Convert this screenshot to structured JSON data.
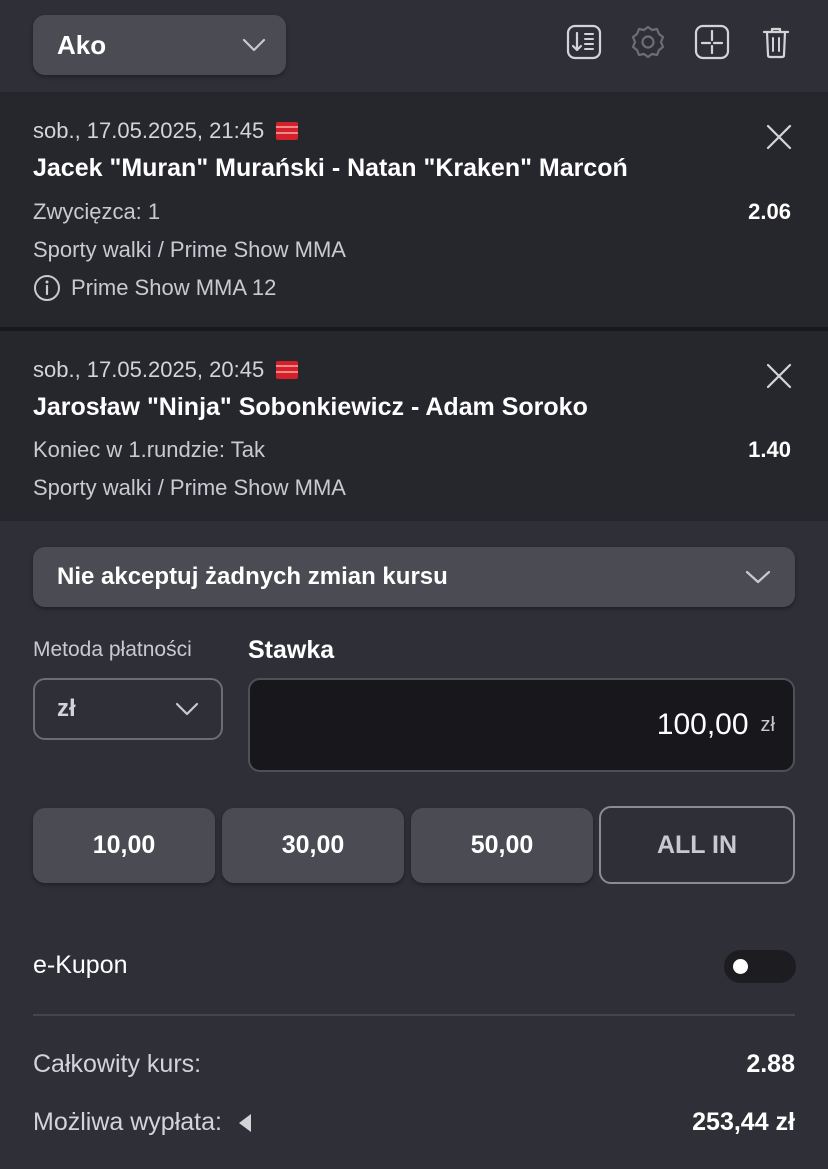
{
  "header": {
    "bet_type": "Ako",
    "icons": [
      "sort-icon",
      "settings-icon",
      "split-icon",
      "trash-icon"
    ]
  },
  "events": [
    {
      "datetime": "sob., 17.05.2025, 21:45",
      "match": "Jacek \"Muran\" Murański - Natan \"Kraken\" Marcoń",
      "market": "Zwycięzca: 1",
      "odd": "2.06",
      "league": "Sporty walki / Prime Show MMA",
      "info": "Prime Show MMA 12"
    },
    {
      "datetime": "sob., 17.05.2025, 20:45",
      "match": "Jarosław \"Ninja\" Sobonkiewicz - Adam Soroko",
      "market": "Koniec w 1.rundzie: Tak",
      "odd": "1.40",
      "league": "Sporty walki / Prime Show MMA"
    }
  ],
  "odds_change": {
    "label": "Nie akceptuj żadnych zmian kursu"
  },
  "payment": {
    "label": "Metoda płatności",
    "currency": "zł"
  },
  "stake": {
    "label": "Stawka",
    "value": "100,00",
    "unit": "zł"
  },
  "quick_stakes": [
    "10,00",
    "30,00",
    "50,00"
  ],
  "all_in": "ALL IN",
  "ekupon": {
    "label": "e-Kupon",
    "enabled": false
  },
  "summary": {
    "total_odds_label": "Całkowity kurs:",
    "total_odds": "2.88",
    "payout_label": "Możliwa wypłata:",
    "payout": "253,44 zł"
  },
  "colors": {
    "background": "#2f3037",
    "card": "#26262d",
    "control": "#4a4b53",
    "input": "#18181c"
  }
}
